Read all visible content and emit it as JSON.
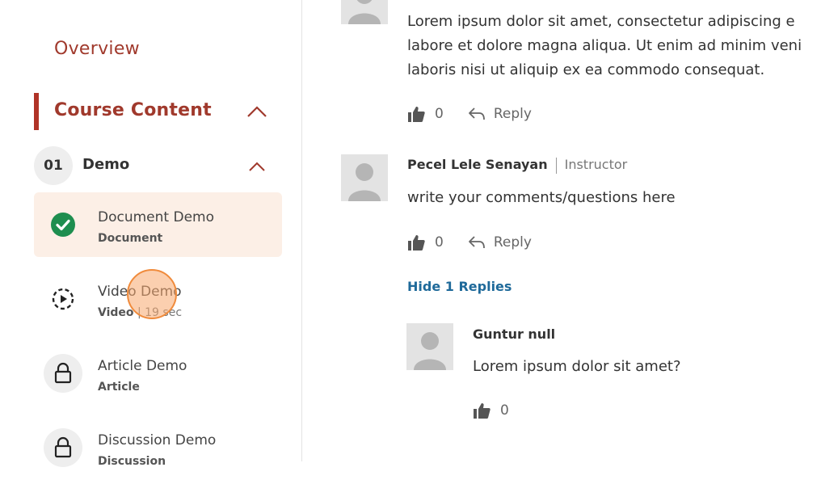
{
  "sidebar": {
    "overview_label": "Overview",
    "course_content_label": "Course Content",
    "section": {
      "number": "01",
      "title": "Demo"
    },
    "lessons": [
      {
        "title": "Document Demo",
        "type": "Document",
        "duration": "",
        "status": "completed"
      },
      {
        "title": "Video Demo",
        "type": "Video",
        "duration": " | 19 sec",
        "status": "in-progress"
      },
      {
        "title": "Article Demo",
        "type": "Article",
        "duration": "",
        "status": "locked"
      },
      {
        "title": "Discussion Demo",
        "type": "Discussion",
        "duration": "",
        "status": "locked"
      }
    ]
  },
  "comments": [
    {
      "text_lines": [
        "Lorem ipsum dolor sit amet, consectetur adipiscing e",
        "labore et dolore magna aliqua. Ut enim ad minim veni",
        "laboris nisi ut aliquip ex ea commodo consequat."
      ],
      "likes": "0",
      "reply_label": "Reply"
    },
    {
      "author": "Pecel Lele Senayan",
      "role": "Instructor",
      "text": "write your comments/questions here",
      "likes": "0",
      "reply_label": "Reply",
      "hide_replies_label": "Hide 1 Replies",
      "replies": [
        {
          "author": "Guntur null",
          "text": "Lorem ipsum dolor sit amet?",
          "likes": "0"
        }
      ]
    }
  ],
  "colors": {
    "accent": "#a0392c",
    "success": "#1e8e4f",
    "link": "#1f6a9a",
    "active_bg": "#fcefe6"
  }
}
